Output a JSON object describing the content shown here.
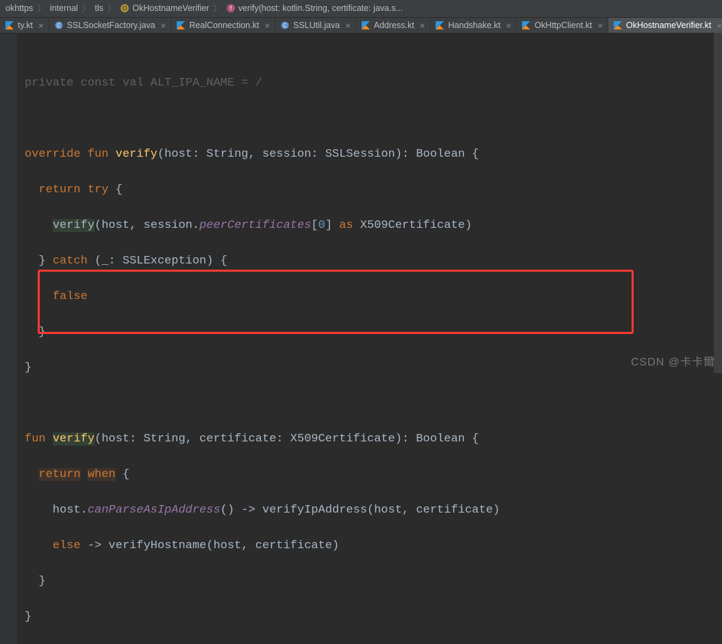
{
  "breadcrumb": {
    "items": [
      "okhttps",
      "internal",
      "tls",
      "OkHostnameVerifier",
      "verify(host: kotlin.String, certificate: java.s..."
    ]
  },
  "tabs": [
    {
      "label": "ty.kt",
      "file_type": "kt",
      "active": false
    },
    {
      "label": "SSLSocketFactory.java",
      "file_type": "java",
      "active": false
    },
    {
      "label": "RealConnection.kt",
      "file_type": "kt",
      "active": false
    },
    {
      "label": "SSLUtil.java",
      "file_type": "java",
      "active": false
    },
    {
      "label": "Address.kt",
      "file_type": "kt",
      "active": false
    },
    {
      "label": "Handshake.kt",
      "file_type": "kt",
      "active": false
    },
    {
      "label": "OkHttpClient.kt",
      "file_type": "kt",
      "active": false
    },
    {
      "label": "OkHostnameVerifier.kt",
      "file_type": "kt",
      "active": true
    }
  ],
  "code": {
    "l1_private": "private",
    "l1_const": "const",
    "l1_val": "val",
    "l1_name": "ALT_IPA_NAME",
    "l1_eq": "=",
    "l1_num": "/",
    "l3_override": "override",
    "l3_fun": "fun",
    "l3_verify": "verify",
    "l3_sig": "(host: String, session: SSLSession): Boolean {",
    "l4_return": "return",
    "l4_try": "try",
    "l4_brace": " {",
    "l5_verify": "verify",
    "l5_open": "(host, session.",
    "l5_peer": "peerCertificates",
    "l5_idx_open": "[",
    "l5_zero": "0",
    "l5_idx_close": "]",
    "l5_as": "as",
    "l5_tail": " X509Certificate)",
    "l6_close": "} ",
    "l6_catch": "catch",
    "l6_sig": " (_: SSLException) {",
    "l7_false": "false",
    "l8": "}",
    "l9": "}",
    "l11_fun": "fun",
    "l11_verify": "verify",
    "l11_sig": "(host: String, certificate: X509Certificate): Boolean {",
    "l12_return": "return",
    "l12_when": "when",
    "l12_brace": " {",
    "l13_pre": "    host.",
    "l13_can": "canParseAsIpAddress",
    "l13_rest": "() -> verifyIpAddress(host, certificate)",
    "l14_indent": "    ",
    "l14_else": "else",
    "l14_rest": " -> verifyHostname(host, certificate)",
    "l15": "  }",
    "l16": "}"
  },
  "watermark": "CSDN @卡卡爾"
}
